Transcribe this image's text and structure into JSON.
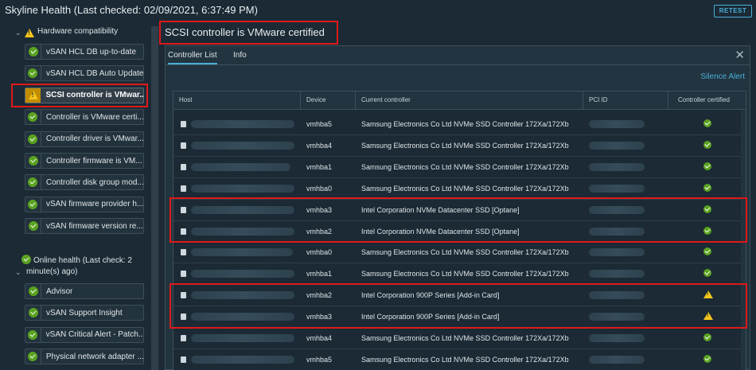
{
  "header": {
    "title": "Skyline Health (Last checked: 02/09/2021, 6:37:49 PM)",
    "retest_label": "RETEST"
  },
  "sidebar": {
    "hardware_section": "Hardware compatibility",
    "hardware_items": [
      {
        "label": "vSAN HCL DB up-to-date",
        "status": "ok"
      },
      {
        "label": "vSAN HCL DB Auto Update",
        "status": "ok"
      },
      {
        "label": "SCSI controller is VMwar...",
        "status": "warning",
        "selected": true
      },
      {
        "label": "Controller is VMware certi...",
        "status": "ok"
      },
      {
        "label": "Controller driver is VMwar...",
        "status": "ok"
      },
      {
        "label": "Controller firmware is VM...",
        "status": "ok"
      },
      {
        "label": "Controller disk group mod...",
        "status": "ok"
      },
      {
        "label": "vSAN firmware provider h...",
        "status": "ok"
      },
      {
        "label": "vSAN firmware version re...",
        "status": "ok"
      }
    ],
    "online_section_line1": "Online health (Last check: 2",
    "online_section_line2": "minute(s) ago)",
    "online_items": [
      {
        "label": "Advisor",
        "status": "ok"
      },
      {
        "label": "vSAN Support Insight",
        "status": "ok"
      },
      {
        "label": "vSAN Critical Alert - Patch...",
        "status": "ok"
      },
      {
        "label": "Physical network adapter ...",
        "status": "ok"
      }
    ]
  },
  "panel": {
    "title": "SCSI controller is VMware certified",
    "tabs": [
      {
        "label": "Controller List",
        "active": true
      },
      {
        "label": "Info",
        "active": false
      }
    ],
    "silence_label": "Silence Alert",
    "columns": {
      "host": "Host",
      "device": "Device",
      "controller": "Current controller",
      "pci": "PCI ID",
      "certified": "Controller certified"
    },
    "rows": [
      {
        "device": "vmhba5",
        "controller": "Samsung Electronics Co Ltd NVMe SSD Controller 172Xa/172Xb",
        "certified": "ok"
      },
      {
        "device": "vmhba4",
        "controller": "Samsung Electronics Co Ltd NVMe SSD Controller 172Xa/172Xb",
        "certified": "ok"
      },
      {
        "device": "vmhba1",
        "controller": "Samsung Electronics Co Ltd NVMe SSD Controller 172Xa/172Xb",
        "certified": "ok"
      },
      {
        "device": "vmhba0",
        "controller": "Samsung Electronics Co Ltd NVMe SSD Controller 172Xa/172Xb",
        "certified": "ok"
      },
      {
        "device": "vmhba3",
        "controller": "Intel Corporation NVMe Datacenter SSD [Optane]",
        "certified": "ok"
      },
      {
        "device": "vmhba2",
        "controller": "Intel Corporation NVMe Datacenter SSD [Optane]",
        "certified": "ok"
      },
      {
        "device": "vmhba0",
        "controller": "Samsung Electronics Co Ltd NVMe SSD Controller 172Xa/172Xb",
        "certified": "ok"
      },
      {
        "device": "vmhba1",
        "controller": "Samsung Electronics Co Ltd NVMe SSD Controller 172Xa/172Xb",
        "certified": "ok"
      },
      {
        "device": "vmhba2",
        "controller": "Intel Corporation 900P Series [Add-in Card]",
        "certified": "warning"
      },
      {
        "device": "vmhba3",
        "controller": "Intel Corporation 900P Series [Add-in Card]",
        "certified": "warning"
      },
      {
        "device": "vmhba4",
        "controller": "Samsung Electronics Co Ltd NVMe SSD Controller 172Xa/172Xb",
        "certified": "ok"
      },
      {
        "device": "vmhba5",
        "controller": "Samsung Electronics Co Ltd NVMe SSD Controller 172Xa/172Xb",
        "certified": "ok"
      }
    ]
  },
  "colors": {
    "background": "#1b2a35",
    "accent": "#49afd9",
    "ok": "#5aa220",
    "warning": "#f4c51c",
    "highlight_box": "#e0191a"
  }
}
